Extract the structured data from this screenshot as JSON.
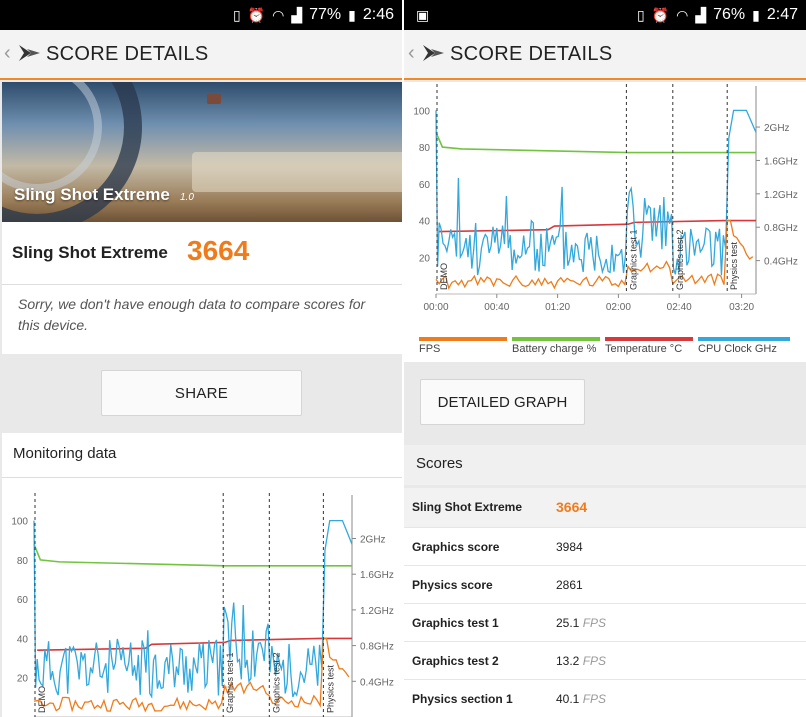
{
  "left_screen": {
    "status": {
      "battery": "77%",
      "time": "2:46"
    },
    "app_bar": {
      "title": "SCORE DETAILS"
    },
    "hero": {
      "title": "Sling Shot Extreme",
      "version": "1.0"
    },
    "score_card": {
      "name": "Sling Shot Extreme",
      "score": "3664",
      "message": "Sorry, we don't have enough data to compare scores for this device."
    },
    "share_button": "SHARE",
    "monitoring": {
      "title": "Monitoring data",
      "y_ticks_left": [
        "100",
        "80",
        "60",
        "40",
        "20"
      ],
      "y_ticks_right": [
        "2GHz",
        "1.6GHz",
        "1.2GHz",
        "0.8GHz",
        "0.4GHz"
      ],
      "phase_labels": [
        "DEMO",
        "Graphics test 1",
        "Graphics test 2",
        "Physics test"
      ]
    }
  },
  "right_screen": {
    "status": {
      "battery": "76%",
      "time": "2:47"
    },
    "app_bar": {
      "title": "SCORE DETAILS"
    },
    "graph": {
      "y_ticks_left": [
        "100",
        "80",
        "60",
        "40",
        "20"
      ],
      "y_ticks_right": [
        "2GHz",
        "1.6GHz",
        "1.2GHz",
        "0.8GHz",
        "0.4GHz"
      ],
      "x_ticks": [
        "00:00",
        "00:40",
        "01:20",
        "02:00",
        "02:40",
        "03:20"
      ],
      "phase_labels": [
        "DEMO",
        "Graphics test 1",
        "Graphics test 2",
        "Physics test"
      ]
    },
    "legend": [
      {
        "label": "FPS",
        "color": "#f07b1b"
      },
      {
        "label": "Battery charge %",
        "color": "#72c43e"
      },
      {
        "label": "Temperature °C",
        "color": "#d9373a"
      },
      {
        "label": "CPU Clock GHz",
        "color": "#33a8dd"
      }
    ],
    "detailed_graph_button": "DETAILED GRAPH",
    "scores": {
      "heading": "Scores",
      "rows": [
        {
          "label": "Sling Shot Extreme",
          "value": "3664",
          "unit": ""
        },
        {
          "label": "Graphics score",
          "value": "3984",
          "unit": ""
        },
        {
          "label": "Physics score",
          "value": "2861",
          "unit": ""
        },
        {
          "label": "Graphics test 1",
          "value": "25.1",
          "unit": "FPS"
        },
        {
          "label": "Graphics test 2",
          "value": "13.2",
          "unit": "FPS"
        },
        {
          "label": "Physics section 1",
          "value": "40.1",
          "unit": "FPS"
        }
      ]
    }
  },
  "colors": {
    "accent": "#f07b1b",
    "battery": "#72c43e",
    "temperature": "#d9373a",
    "cpu": "#33a8dd"
  }
}
